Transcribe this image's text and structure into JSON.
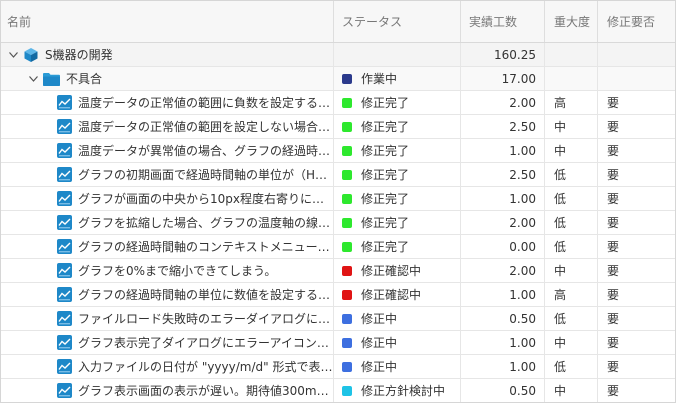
{
  "columns": {
    "name": "名前",
    "status": "ステータス",
    "hours": "実績工数",
    "severity": "重大度",
    "fix_required": "修正要否"
  },
  "colors": {
    "in_progress_dark": "#2b3a8c",
    "fixed": "#2ee82e",
    "confirm": "#e01414",
    "fixing": "#3d6fe0",
    "policy": "#1ec3e6",
    "icon_blue": "#1e88c8"
  },
  "tree": {
    "project": {
      "name": "S機器の開発",
      "hours": "160.25",
      "icon": "cube-icon"
    },
    "group": {
      "name": "不具合",
      "status": "作業中",
      "hours": "17.00",
      "icon": "folder-icon"
    },
    "items": [
      {
        "name": "温度データの正常値の範囲に負数を設定する…",
        "status": "修正完了",
        "status_color": "#2ee82e",
        "hours": "2.00",
        "severity": "高",
        "fix": "要"
      },
      {
        "name": "温度データの正常値の範囲を設定しない場合…",
        "status": "修正完了",
        "status_color": "#2ee82e",
        "hours": "2.50",
        "severity": "中",
        "fix": "要"
      },
      {
        "name": "温度データが異常値の場合、グラフの経過時…",
        "status": "修正完了",
        "status_color": "#2ee82e",
        "hours": "1.00",
        "severity": "中",
        "fix": "要"
      },
      {
        "name": "グラフの初期画面で経過時間軸の単位が（H）…",
        "status": "修正完了",
        "status_color": "#2ee82e",
        "hours": "2.50",
        "severity": "低",
        "fix": "要"
      },
      {
        "name": "グラフが画面の中央から10px程度右寄りに表…",
        "status": "修正完了",
        "status_color": "#2ee82e",
        "hours": "1.00",
        "severity": "低",
        "fix": "要"
      },
      {
        "name": "グラフを拡縮した場合、グラフの温度軸の線…",
        "status": "修正完了",
        "status_color": "#2ee82e",
        "hours": "2.00",
        "severity": "低",
        "fix": "要"
      },
      {
        "name": "グラフの経過時間軸のコンテキストメニュー…",
        "status": "修正完了",
        "status_color": "#2ee82e",
        "hours": "0.00",
        "severity": "低",
        "fix": "要"
      },
      {
        "name": "グラフを0%まで縮小できてしまう。",
        "status": "修正確認中",
        "status_color": "#e01414",
        "hours": "2.00",
        "severity": "中",
        "fix": "要"
      },
      {
        "name": "グラフの経過時間軸の単位に数値を設定する…",
        "status": "修正確認中",
        "status_color": "#e01414",
        "hours": "1.00",
        "severity": "高",
        "fix": "要"
      },
      {
        "name": "ファイルロード失敗時のエラーダイアログに…",
        "status": "修正中",
        "status_color": "#3d6fe0",
        "hours": "0.50",
        "severity": "低",
        "fix": "要"
      },
      {
        "name": "グラフ表示完了ダイアログにエラーアイコン…",
        "status": "修正中",
        "status_color": "#3d6fe0",
        "hours": "1.00",
        "severity": "中",
        "fix": "要"
      },
      {
        "name": "入力ファイルの日付が \"yyyy/m/d\" 形式で表…",
        "status": "修正中",
        "status_color": "#3d6fe0",
        "hours": "1.00",
        "severity": "低",
        "fix": "要"
      },
      {
        "name": "グラフ表示画面の表示が遅い。期待値300ms…",
        "status": "修正方針検討中",
        "status_color": "#1ec3e6",
        "hours": "0.50",
        "severity": "中",
        "fix": "要"
      }
    ]
  }
}
